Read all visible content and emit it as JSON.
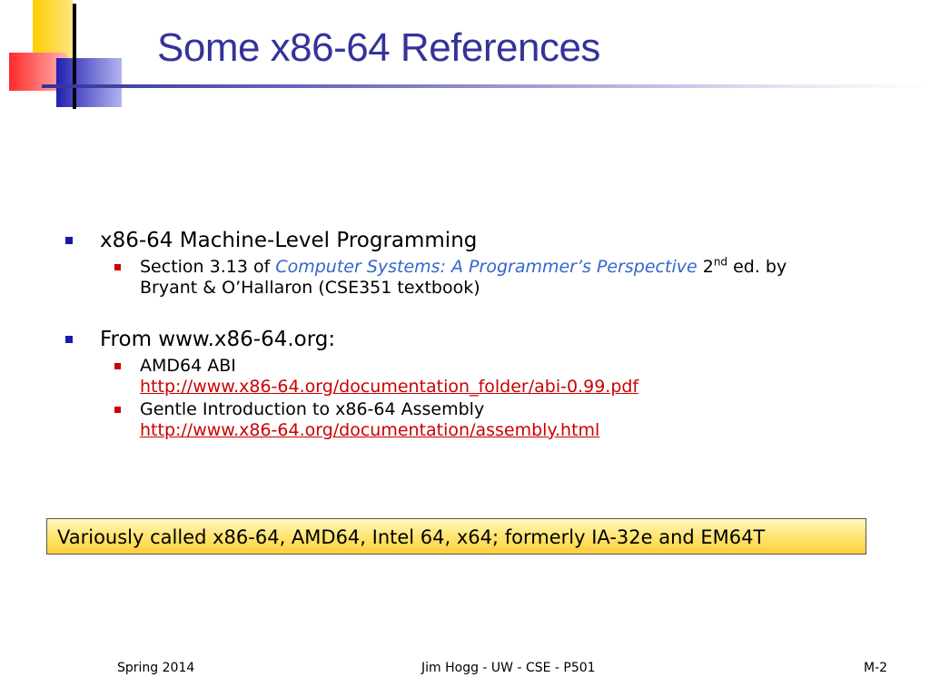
{
  "slide": {
    "title": "Some x86-64 References",
    "colors": {
      "title": "#333399",
      "bullet_l1": "#1a1aa6",
      "bullet_l2": "#cc0000",
      "book_title": "#3366cc",
      "link": "#cc0000",
      "note_bg": "#ffe36b"
    },
    "bullets": [
      {
        "text": "x86-64 Machine-Level Programming",
        "sub": {
          "prefix": "Section 3.13 of ",
          "book": "Computer Systems: A Programmer’s Perspective",
          "mid": " 2",
          "sup": "nd",
          "suffix": " ed. by",
          "line2": "Bryant & O’Hallaron (CSE351 textbook)"
        }
      },
      {
        "text": "From www.x86-64.org:",
        "subs": [
          {
            "label": "AMD64 ABI",
            "link": "http://www.x86-64.org/documentation_folder/abi-0.99.pdf"
          },
          {
            "label": "Gentle Introduction to x86-64 Assembly",
            "link": "http://www.x86-64.org/documentation/assembly.html"
          }
        ]
      }
    ],
    "note": "Variously called x86-64, AMD64, Intel 64, x64; formerly IA-32e and EM64T"
  },
  "footer": {
    "left": "Spring 2014",
    "center": "Jim Hogg - UW - CSE - P501",
    "right": "M-2"
  }
}
